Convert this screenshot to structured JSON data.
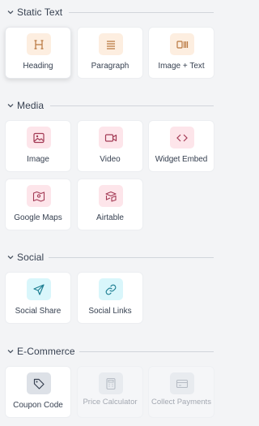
{
  "sections": [
    {
      "title": "Static Text",
      "items": [
        {
          "label": "Heading",
          "icon": "heading-icon"
        },
        {
          "label": "Paragraph",
          "icon": "paragraph-icon"
        },
        {
          "label": "Image + Text",
          "icon": "image-text-icon"
        }
      ]
    },
    {
      "title": "Media",
      "items": [
        {
          "label": "Image",
          "icon": "image-icon"
        },
        {
          "label": "Video",
          "icon": "video-icon"
        },
        {
          "label": "Widget Embed",
          "icon": "code-icon"
        },
        {
          "label": "Google Maps",
          "icon": "map-icon"
        },
        {
          "label": "Airtable",
          "icon": "airtable-icon"
        }
      ]
    },
    {
      "title": "Social",
      "items": [
        {
          "label": "Social Share",
          "icon": "send-icon"
        },
        {
          "label": "Social Links",
          "icon": "link-icon"
        }
      ]
    },
    {
      "title": "E-Commerce",
      "items": [
        {
          "label": "Coupon Code",
          "icon": "tag-icon"
        },
        {
          "label": "Price Calculator",
          "icon": "calculator-icon",
          "disabled": true
        },
        {
          "label": "Collect Payments",
          "icon": "credit-card-icon",
          "disabled": true
        }
      ]
    }
  ],
  "colors": {
    "static_icon_bg": "#fdeee0",
    "static_icon_fg": "#b9773f",
    "media_icon_bg": "#fde5ea",
    "media_icon_fg": "#a33a55",
    "social_icon_bg": "#d9f6fb",
    "social_icon_fg": "#1f7f93",
    "ecom_icon_bg": "#dde1e7",
    "ecom_icon_fg": "#374151",
    "disabled_icon_fg": "#b6bcc5"
  }
}
